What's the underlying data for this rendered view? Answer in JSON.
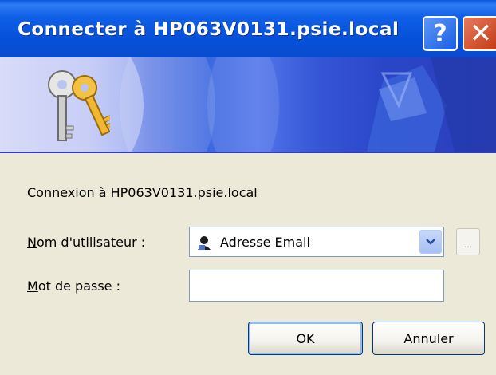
{
  "window": {
    "title": "Connecter à HP063V0131.psie.local"
  },
  "titlebar": {
    "help_label": "?",
    "close_label": "✕"
  },
  "message": "Connexion à HP063V0131.psie.local",
  "username": {
    "label_accel": "N",
    "label_rest": "om d'utilisateur :",
    "value": "Adresse Email",
    "browse_label": "..."
  },
  "password": {
    "label_accel": "M",
    "label_rest": "ot de passe :",
    "value": ""
  },
  "buttons": {
    "ok": "OK",
    "cancel": "Annuler"
  },
  "colors": {
    "titlebar": "#0a58e0",
    "dialog_bg": "#ece9d8",
    "field_border": "#7f9db9"
  }
}
